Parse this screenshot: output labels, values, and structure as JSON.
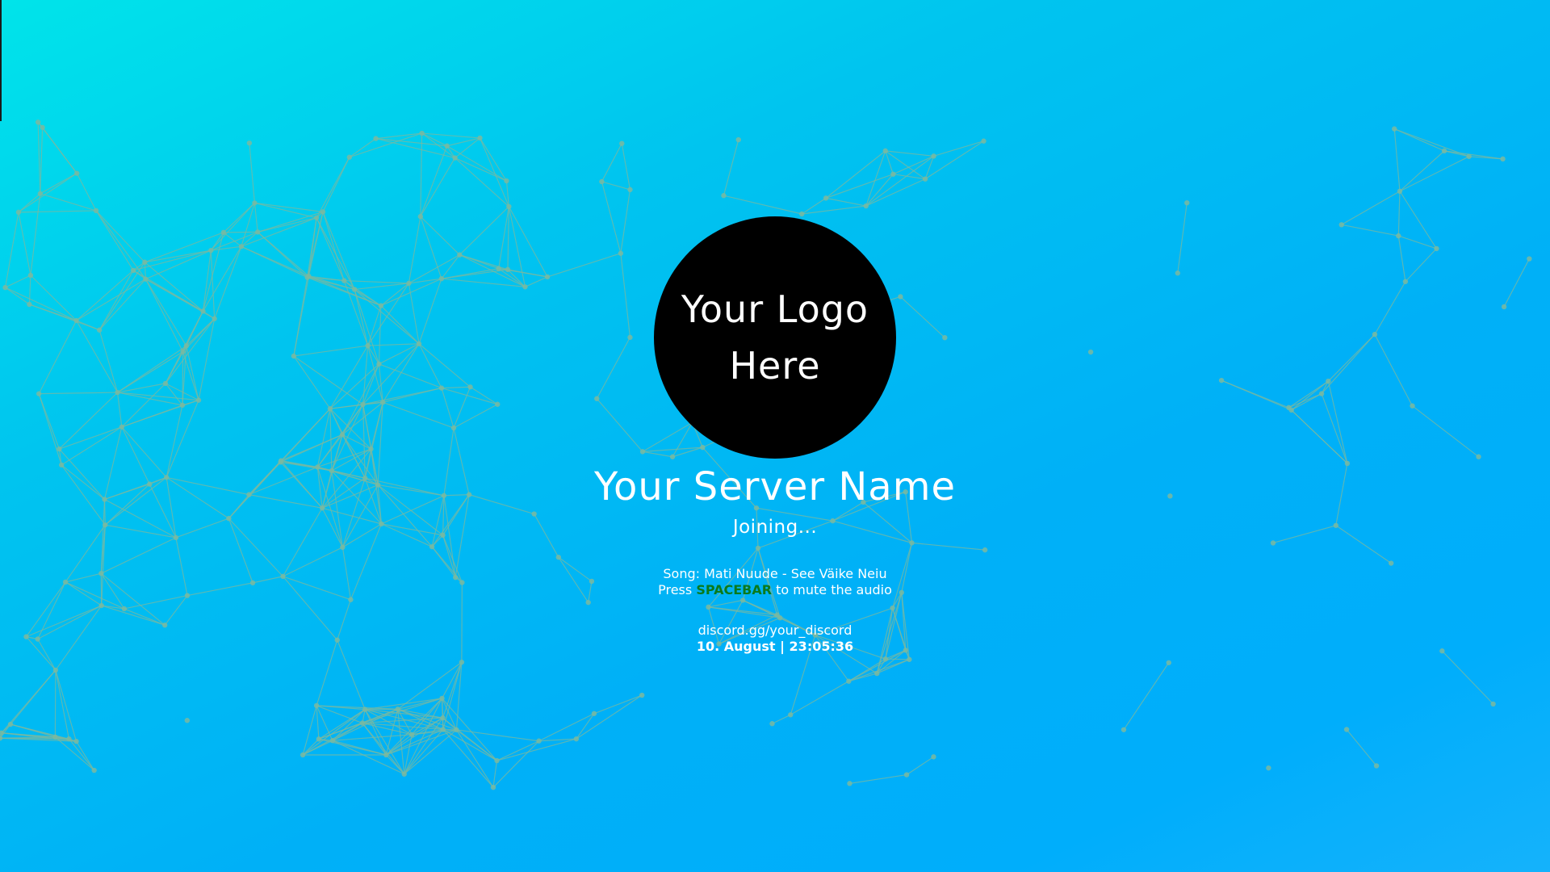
{
  "logo": {
    "line1": "Your Logo",
    "line2": "Here"
  },
  "server": {
    "name": "Your Server Name",
    "status": "Joining..."
  },
  "music": {
    "song": "Song: Mati Nuude - See Väike Neiu",
    "mute_prefix": "Press ",
    "mute_key": "SPACEBAR",
    "mute_suffix": " to mute the audio"
  },
  "footer": {
    "discord": "discord.gg/your_discord",
    "datetime": "10. August | 23:05:36"
  },
  "colors": {
    "background_start": "#00e4ea",
    "background_end": "#00aefb",
    "network": "#7ab8a0",
    "accent_key": "#0a7a1c",
    "logo_bg": "#000000",
    "text": "#ffffff"
  },
  "icons": {
    "background": "particle-network-icon"
  }
}
